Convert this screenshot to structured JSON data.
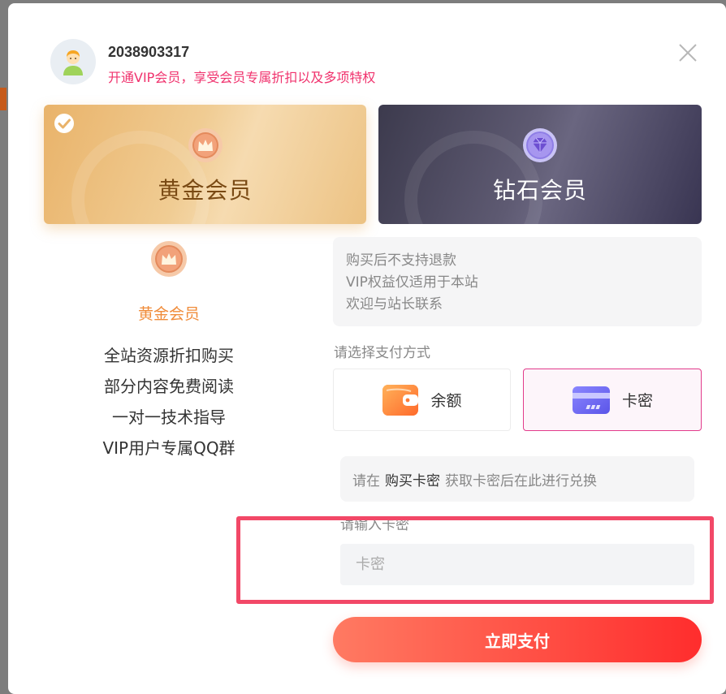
{
  "user": {
    "id": "2038903317",
    "promo": "开通VIP会员，享受会员专属折扣以及多项特权"
  },
  "plans": [
    {
      "name": "黄金会员",
      "selected": true
    },
    {
      "name": "钻石会员",
      "selected": false
    }
  ],
  "selected_plan": {
    "level": "黄金会员",
    "benefits": [
      "全站资源折扣购买",
      "部分内容免费阅读",
      "一对一技术指导",
      "VIP用户专属QQ群"
    ]
  },
  "notice": {
    "lines": [
      "购买后不支持退款",
      "VIP权益仅适用于本站",
      "欢迎与站长联系"
    ]
  },
  "payment": {
    "title": "请选择支付方式",
    "options": [
      {
        "label": "余额",
        "icon": "wallet-icon",
        "selected": false
      },
      {
        "label": "卡密",
        "icon": "credit-card-icon",
        "selected": true
      }
    ]
  },
  "card_tip": {
    "prefix": "请在",
    "link": "购买卡密",
    "suffix": "获取卡密后在此进行兑换"
  },
  "card_field": {
    "label": "请输入卡密",
    "placeholder": "卡密",
    "value": ""
  },
  "submit_label": "立即支付",
  "colors": {
    "promo": "#f0326d",
    "gold_accent": "#f08c3a",
    "selected_border": "#e23b8b",
    "highlight": "#f24867",
    "button_start": "#ff7a62",
    "button_end": "#ff2d2d"
  }
}
